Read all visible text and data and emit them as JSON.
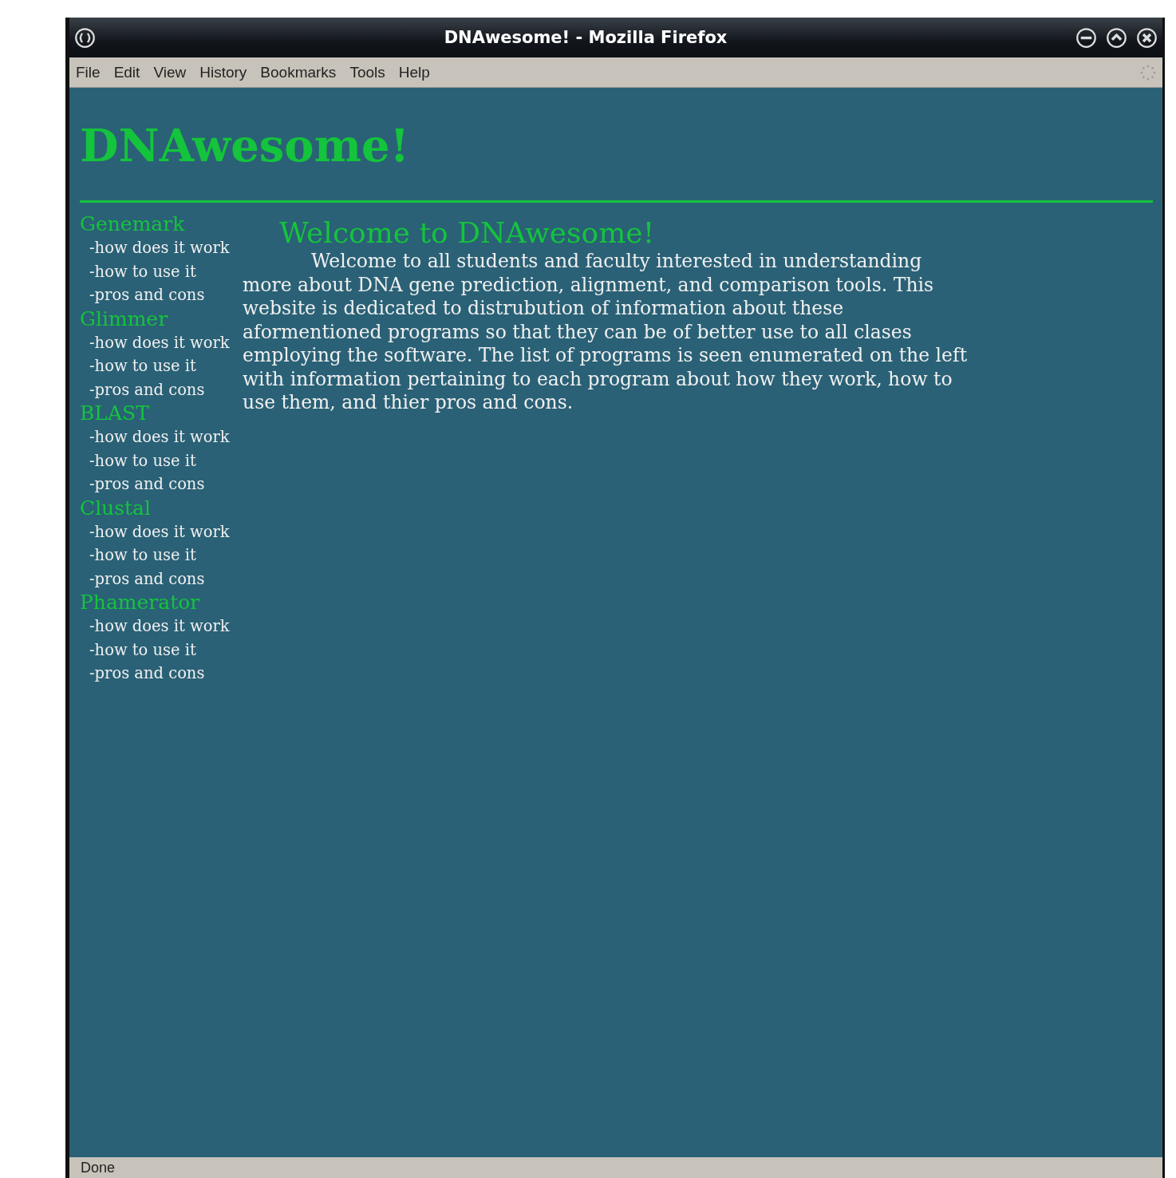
{
  "window": {
    "title": "DNAwesome! - Mozilla Firefox"
  },
  "menu": [
    {
      "label": "File"
    },
    {
      "label": "Edit"
    },
    {
      "label": "View"
    },
    {
      "label": "History"
    },
    {
      "label": "Bookmarks"
    },
    {
      "label": "Tools"
    },
    {
      "label": "Help"
    }
  ],
  "page": {
    "title": "DNAwesome!",
    "sidebar": [
      {
        "label": "Genemark",
        "children": [
          {
            "label": "-how does it work"
          },
          {
            "label": "-how to use it"
          },
          {
            "label": "-pros and cons"
          }
        ]
      },
      {
        "label": "Glimmer",
        "children": [
          {
            "label": "-how does it work"
          },
          {
            "label": "-how to use it"
          },
          {
            "label": "-pros and cons"
          }
        ]
      },
      {
        "label": "BLAST",
        "children": [
          {
            "label": "-how does it work"
          },
          {
            "label": "-how to use it"
          },
          {
            "label": "-pros and cons"
          }
        ]
      },
      {
        "label": "Clustal",
        "children": [
          {
            "label": "-how does it work"
          },
          {
            "label": "-how to use it"
          },
          {
            "label": "-pros and cons"
          }
        ]
      },
      {
        "label": "Phamerator",
        "children": [
          {
            "label": "-how does it work"
          },
          {
            "label": "-how to use it"
          },
          {
            "label": "-pros and cons"
          }
        ]
      }
    ],
    "heading": "Welcome to DNAwesome!",
    "paragraph": "Welcome to all students and faculty interested in understanding more about DNA gene prediction, alignment, and comparison tools. This website is dedicated to distrubution of information about these aformentioned programs so that they can be of better use to all clases employing the software. The list of programs is seen enumerated on the left with information pertaining to each program about how they work, how to use them, and thier pros and cons."
  },
  "status_bar": {
    "text": "Done"
  }
}
